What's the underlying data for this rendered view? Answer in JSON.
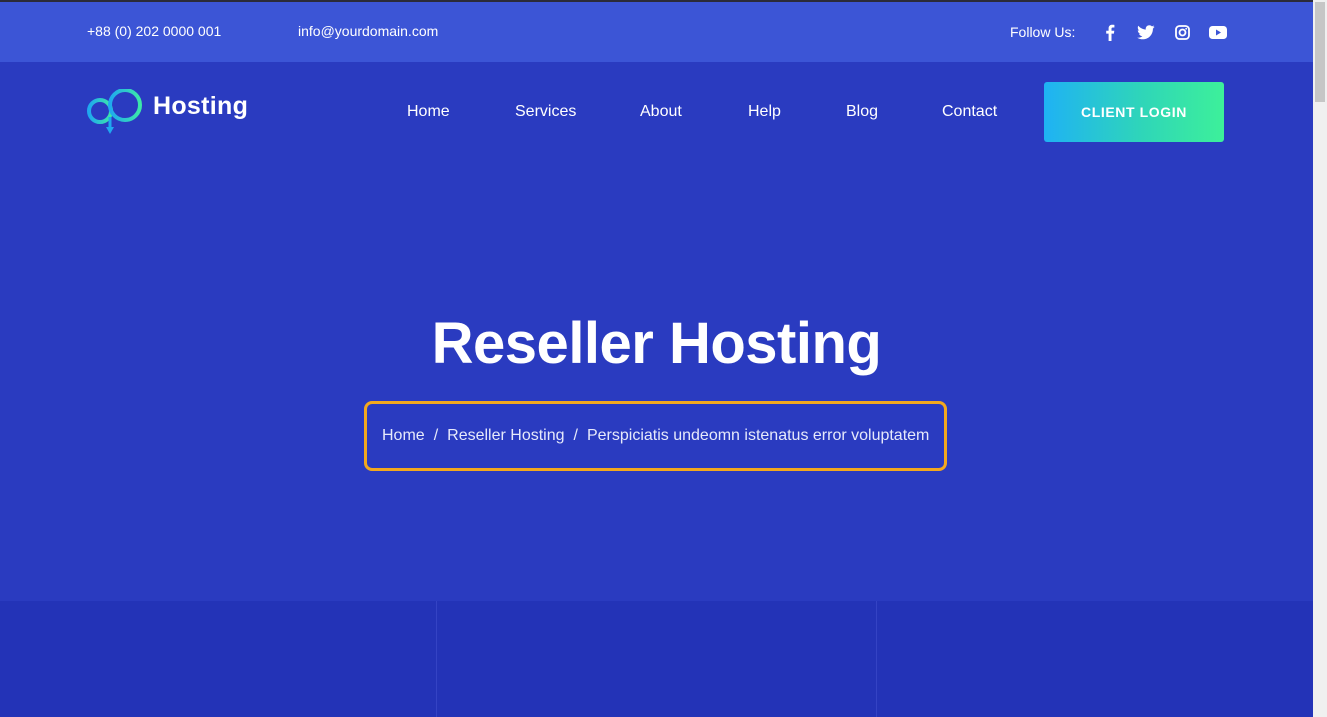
{
  "topbar": {
    "phone": "+88 (0) 202 0000 001",
    "email": "info@yourdomain.com",
    "follow_label": "Follow Us:",
    "social": [
      "facebook-icon",
      "twitter-icon",
      "instagram-icon",
      "youtube-icon"
    ]
  },
  "logo": {
    "text": "Hosting"
  },
  "nav": {
    "items": [
      "Home",
      "Services",
      "About",
      "Help",
      "Blog",
      "Contact"
    ],
    "login_label": "CLIENT LOGIN"
  },
  "hero": {
    "title": "Reseller Hosting",
    "breadcrumb": [
      "Home",
      "Reseller Hosting",
      "Perspiciatis undeomn istenatus error voluptatem"
    ],
    "separator": "/"
  },
  "colors": {
    "background": "#2a3bc0",
    "topbar": "#3c55d6",
    "highlight_border": "#f3a81e",
    "button_gradient_start": "#1fb2f4",
    "button_gradient_end": "#3df09a"
  }
}
